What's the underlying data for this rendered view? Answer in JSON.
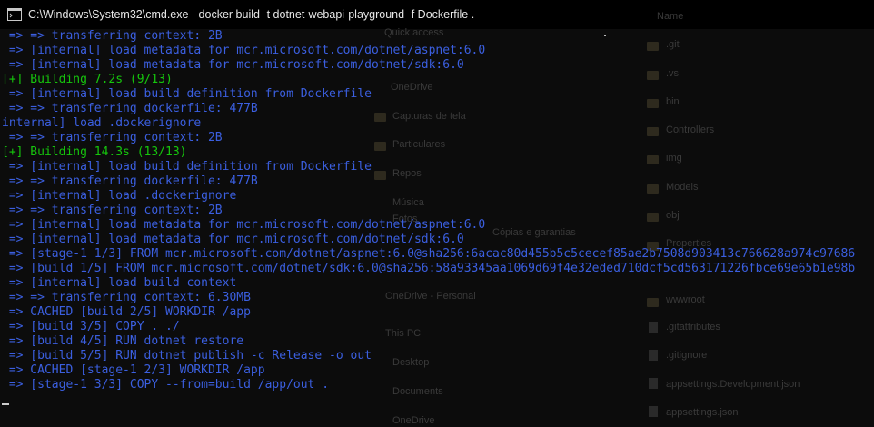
{
  "window": {
    "title": "C:\\Windows\\System32\\cmd.exe - docker  build -t dotnet-webapi-playground -f Dockerfile ."
  },
  "background_explorer": {
    "left_items": [
      "Quick access",
      "OneDrive",
      "Capturas de tela",
      "Particulares",
      "Repos",
      "Música",
      "Fotos",
      "Cópias e garantias",
      "OneDrive - Personal",
      "This PC",
      "Desktop",
      "Documents",
      "OneDrive"
    ],
    "right_header": "Name",
    "right_items": [
      ".git",
      ".vs",
      "bin",
      "Controllers",
      "img",
      "Models",
      "obj",
      "Properties",
      "wwwroot",
      ".gitattributes",
      ".gitignore",
      "appsettings.Development.json",
      "appsettings.json"
    ]
  },
  "terminal": {
    "lines": [
      {
        "text": " => => transferring context: 2B",
        "color": "blue"
      },
      {
        "text": " => [internal] load metadata for mcr.microsoft.com/dotnet/aspnet:6.0",
        "color": "blue"
      },
      {
        "text": " => [internal] load metadata for mcr.microsoft.com/dotnet/sdk:6.0",
        "color": "blue"
      },
      {
        "text": "[+] Building 7.2s (9/13)",
        "color": "green"
      },
      {
        "text": " => [internal] load build definition from Dockerfile",
        "color": "blue"
      },
      {
        "text": " => => transferring dockerfile: 477B",
        "color": "blue"
      },
      {
        "text": "internal] load .dockerignore",
        "color": "blue"
      },
      {
        "text": " => => transferring context: 2B",
        "color": "blue"
      },
      {
        "text": "[+] Building 14.3s (13/13)",
        "color": "green"
      },
      {
        "text": " => [internal] load build definition from Dockerfile",
        "color": "blue"
      },
      {
        "text": " => => transferring dockerfile: 477B",
        "color": "blue"
      },
      {
        "text": " => [internal] load .dockerignore",
        "color": "blue"
      },
      {
        "text": " => => transferring context: 2B",
        "color": "blue"
      },
      {
        "text": " => [internal] load metadata for mcr.microsoft.com/dotnet/aspnet:6.0",
        "color": "blue"
      },
      {
        "text": " => [internal] load metadata for mcr.microsoft.com/dotnet/sdk:6.0",
        "color": "blue"
      },
      {
        "text": " => [stage-1 1/3] FROM mcr.microsoft.com/dotnet/aspnet:6.0@sha256:6acac80d455b5c5cecef85ae2b7508d903413c766628a974c97686",
        "color": "blue"
      },
      {
        "text": " => [build 1/5] FROM mcr.microsoft.com/dotnet/sdk:6.0@sha256:58a93345aa1069d69f4e32eded710dcf5cd563171226fbce69e65b1e98b",
        "color": "blue"
      },
      {
        "text": " => [internal] load build context",
        "color": "blue"
      },
      {
        "text": " => => transferring context: 6.30MB",
        "color": "blue"
      },
      {
        "text": " => CACHED [build 2/5] WORKDIR /app",
        "color": "blue"
      },
      {
        "text": " => [build 3/5] COPY . ./",
        "color": "blue"
      },
      {
        "text": " => [build 4/5] RUN dotnet restore",
        "color": "blue"
      },
      {
        "text": " => [build 5/5] RUN dotnet publish -c Release -o out",
        "color": "blue"
      },
      {
        "text": " => CACHED [stage-1 2/3] WORKDIR /app",
        "color": "blue"
      },
      {
        "text": " => [stage-1 3/3] COPY --from=build /app/out .",
        "color": "blue"
      }
    ]
  }
}
